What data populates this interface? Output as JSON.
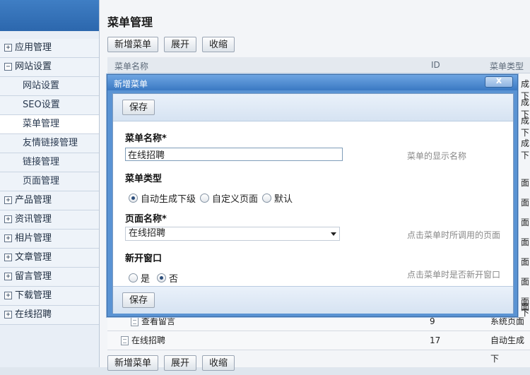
{
  "sidebar": {
    "items": [
      {
        "label": "应用管理",
        "toggle": "+",
        "level": 0
      },
      {
        "label": "网站设置",
        "toggle": "−",
        "level": 0
      },
      {
        "label": "网站设置",
        "level": 1
      },
      {
        "label": "SEO设置",
        "level": 1
      },
      {
        "label": "菜单管理",
        "level": 1,
        "active": true
      },
      {
        "label": "友情链接管理",
        "level": 1
      },
      {
        "label": "链接管理",
        "level": 1
      },
      {
        "label": "页面管理",
        "level": 1
      },
      {
        "label": "产品管理",
        "toggle": "+",
        "level": 0
      },
      {
        "label": "资讯管理",
        "toggle": "+",
        "level": 0
      },
      {
        "label": "相片管理",
        "toggle": "+",
        "level": 0
      },
      {
        "label": "文章管理",
        "toggle": "+",
        "level": 0
      },
      {
        "label": "留言管理",
        "toggle": "+",
        "level": 0
      },
      {
        "label": "下载管理",
        "toggle": "+",
        "level": 0
      },
      {
        "label": "在线招聘",
        "toggle": "+",
        "level": 0
      }
    ]
  },
  "page": {
    "title": "菜单管理",
    "toolbar": {
      "add": "新增菜单",
      "expand": "展开",
      "collapse": "收缩"
    },
    "table": {
      "headers": {
        "name": "菜单名称",
        "id": "ID",
        "type": "菜单类型"
      },
      "rows": [
        {
          "name": "查看留言",
          "id": "9",
          "type": "系统页面"
        },
        {
          "name": "在线招聘",
          "id": "17",
          "type": "自动生成下"
        }
      ],
      "peek_types": [
        "成下",
        "成下",
        "成下",
        "成下",
        "面",
        "面",
        "面",
        "面",
        "面",
        "面",
        "面",
        "面",
        "下"
      ]
    }
  },
  "modal": {
    "title": "新增菜单",
    "close": "x",
    "save": "保存",
    "fields": {
      "name": {
        "label": "菜单名称*",
        "value": "在线招聘",
        "hint": "菜单的显示名称"
      },
      "type": {
        "label": "菜单类型",
        "options": [
          "自动生成下级",
          "自定义页面",
          "默认"
        ],
        "selected": 0
      },
      "page": {
        "label": "页面名称*",
        "value": "在线招聘",
        "hint": "点击菜单时所调用的页面"
      },
      "newwin": {
        "label": "新开窗口",
        "options": [
          "是",
          "否"
        ],
        "selected": 1,
        "hint": "点击菜单时是否新开窗口"
      }
    }
  }
}
